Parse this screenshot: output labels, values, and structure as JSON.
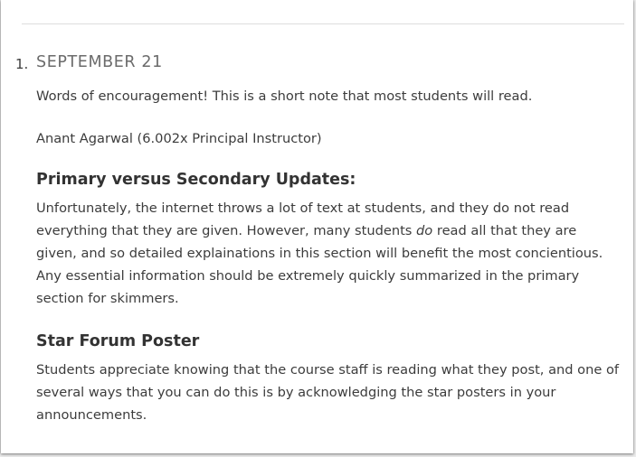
{
  "update": {
    "number": "1.",
    "date": "SEPTEMBER 21",
    "intro": "Words of encouragement! This is a short note that most students will read.",
    "signature": "Anant Agarwal (6.002x Principal Instructor)",
    "sections": [
      {
        "heading": "Primary versus Secondary Updates:",
        "body_before_em": "Unfortunately, the internet throws a lot of text at students, and they do not read everything that they are given. However, many students ",
        "body_em": "do",
        "body_after_em": " read all that they are given, and so detailed explainations in this section will benefit the most concientious. Any essential information should be extremely quickly summarized in the primary section for skimmers."
      },
      {
        "heading": "Star Forum Poster",
        "body": "Students appreciate knowing that the course staff is reading what they post, and one of several ways that you can do this is by acknowledging the star posters in your announcements."
      }
    ]
  }
}
